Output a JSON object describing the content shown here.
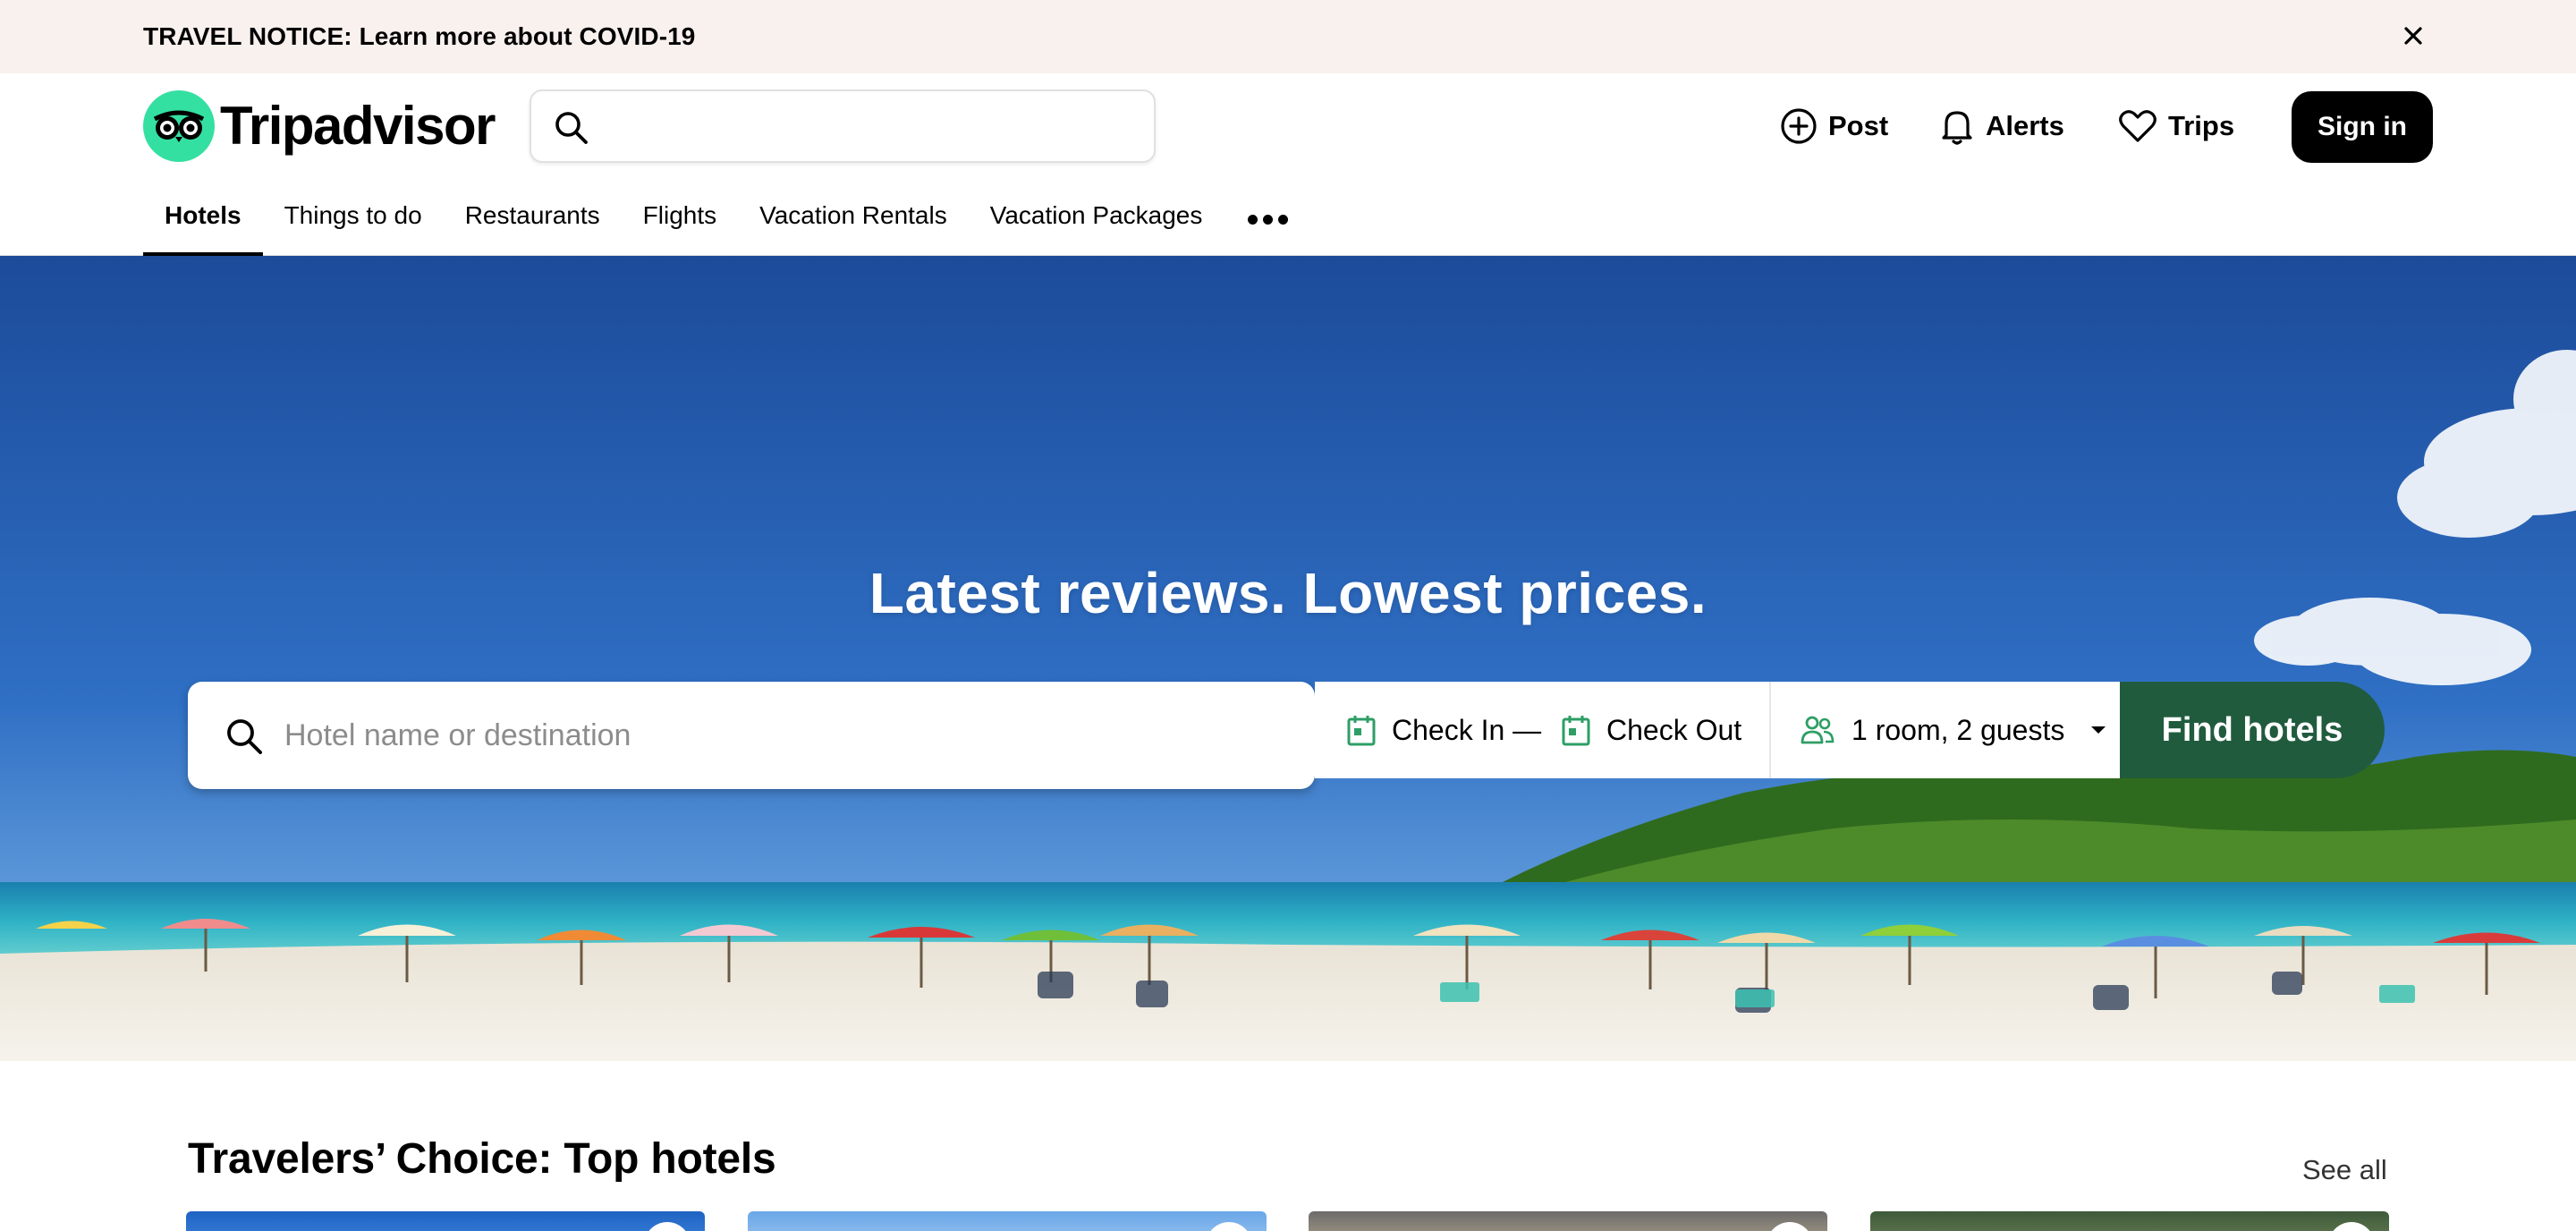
{
  "notice": {
    "text": "TRAVEL NOTICE: Learn more about COVID-19",
    "close_icon": "close-icon"
  },
  "header": {
    "logo_text": "Tripadvisor",
    "search": {
      "value": "",
      "placeholder": ""
    },
    "actions": {
      "post": "Post",
      "alerts": "Alerts",
      "trips": "Trips"
    },
    "sign_in": "Sign in"
  },
  "nav": {
    "items": [
      {
        "label": "Hotels",
        "active": true
      },
      {
        "label": "Things to do",
        "active": false
      },
      {
        "label": "Restaurants",
        "active": false
      },
      {
        "label": "Flights",
        "active": false
      },
      {
        "label": "Vacation Rentals",
        "active": false
      },
      {
        "label": "Vacation Packages",
        "active": false
      }
    ],
    "more_icon": "more-dots-icon"
  },
  "hero": {
    "title": "Latest reviews. Lowest prices.",
    "search_placeholder": "Hotel name or destination",
    "check_in": "Check In —",
    "check_out": "Check Out",
    "guests": "1 room, 2 guests",
    "find_button": "Find hotels"
  },
  "section": {
    "title": "Travelers’ Choice: Top hotels",
    "see_all": "See all"
  },
  "colors": {
    "brand_green": "#34e0a1",
    "find_button": "#215b3e",
    "notice_bg": "#f9f1ee",
    "calendar_icon": "#2e9e65"
  }
}
